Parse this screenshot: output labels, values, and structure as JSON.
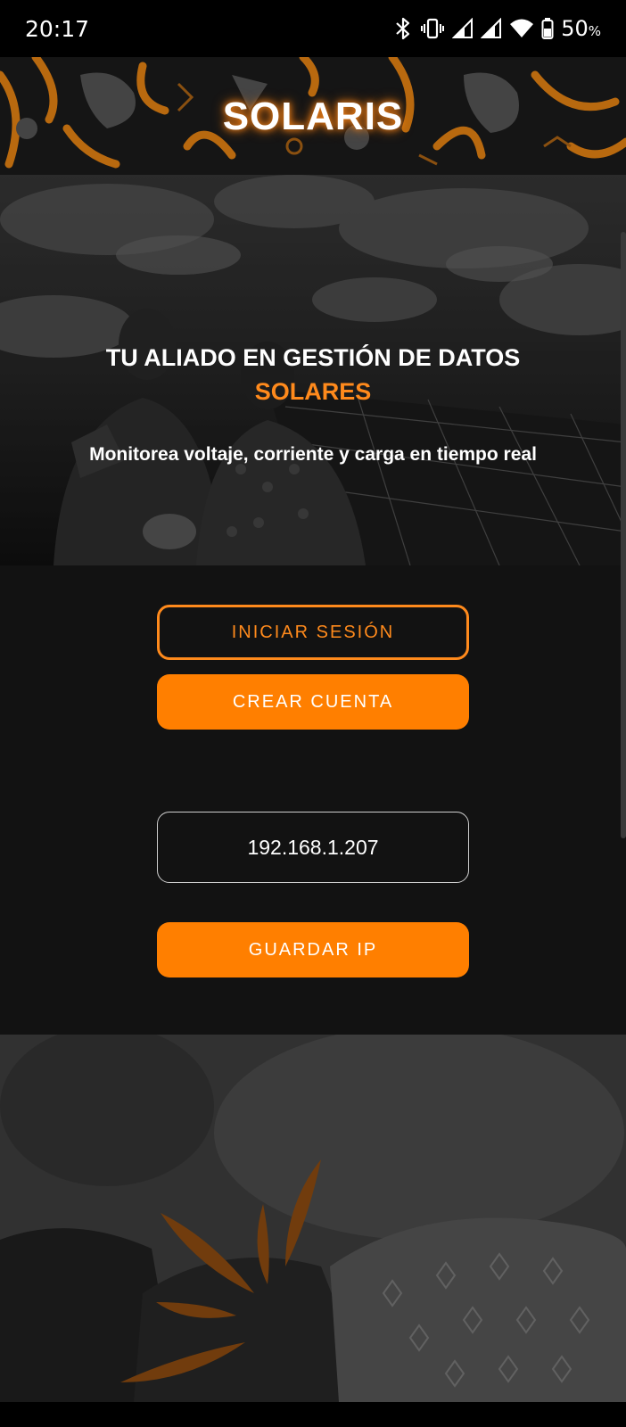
{
  "status_bar": {
    "time": "20:17",
    "battery_percent": "50",
    "battery_unit": "%",
    "icons": [
      "bluetooth-icon",
      "vibrate-icon",
      "signal-icon",
      "signal-icon",
      "wifi-icon",
      "battery-icon"
    ]
  },
  "header": {
    "title": "SOLARIS"
  },
  "hero": {
    "title_line1": "TU ALIADO EN GESTIÓN DE DATOS",
    "title_line2": "SOLARES",
    "subtitle": "Monitorea voltaje, corriente y carga en tiempo real"
  },
  "actions": {
    "login_label": "INICIAR SESIÓN",
    "create_label": "CREAR CUENTA",
    "ip_value": "192.168.1.207",
    "save_ip_label": "GUARDAR IP"
  },
  "colors": {
    "accent": "#ff7f00",
    "accent_text": "#ff8a1c",
    "panel_bg": "#121212"
  }
}
